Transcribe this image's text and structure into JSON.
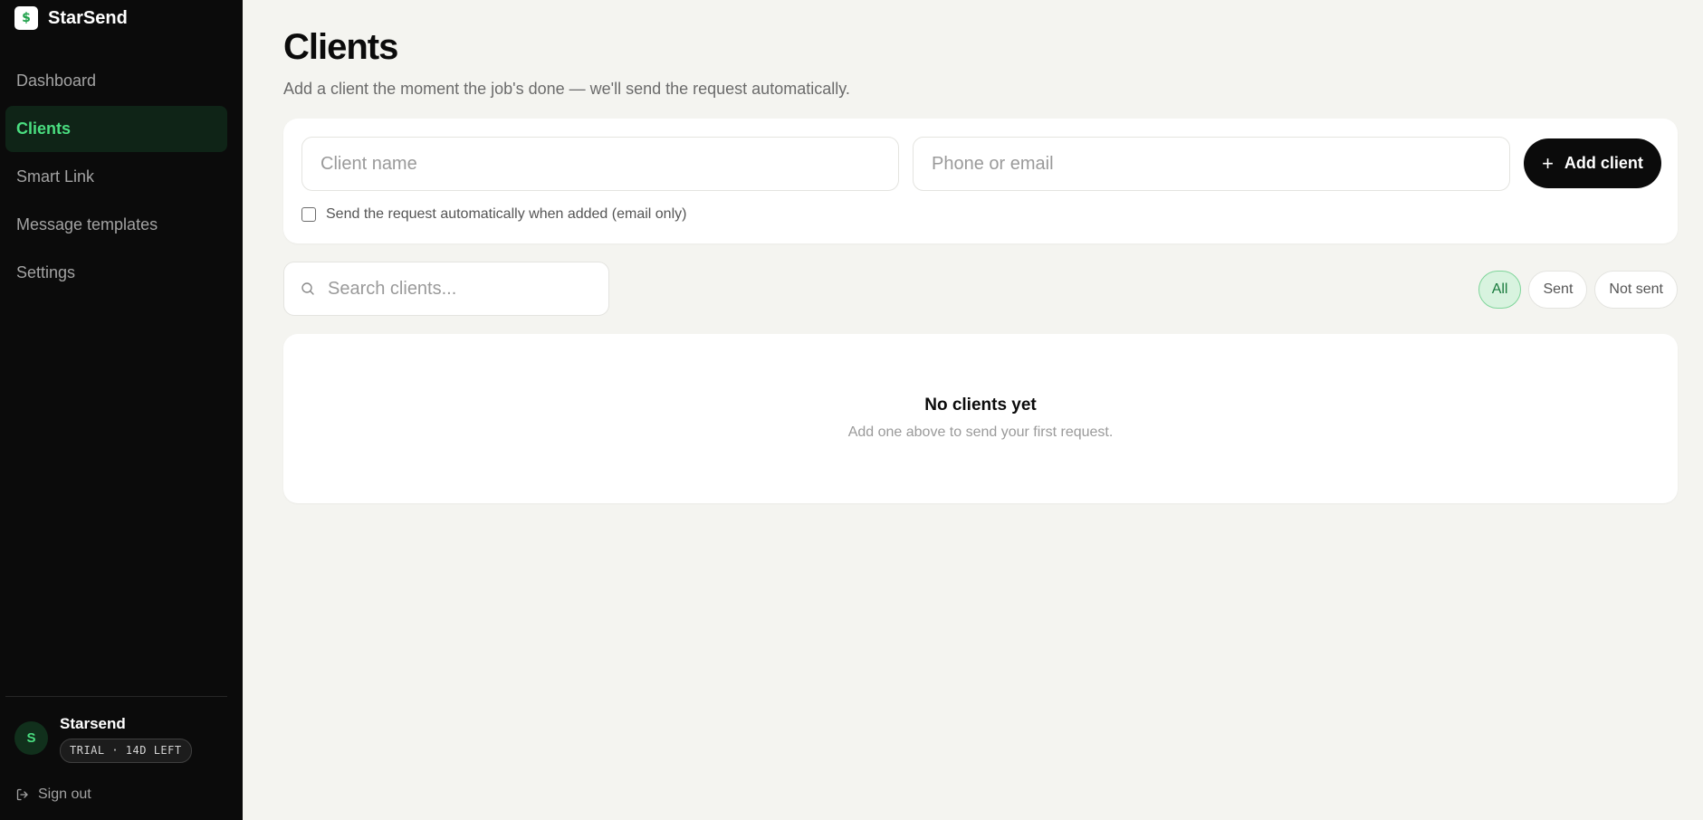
{
  "brand": {
    "name": "StarSend",
    "logo_glyph": "$"
  },
  "sidebar": {
    "items": [
      {
        "label": "Dashboard",
        "active": false
      },
      {
        "label": "Clients",
        "active": true
      },
      {
        "label": "Smart Link",
        "active": false
      },
      {
        "label": "Message templates",
        "active": false
      },
      {
        "label": "Settings",
        "active": false
      }
    ],
    "user": {
      "avatar_initial": "S",
      "name": "Starsend",
      "badge": "TRIAL · 14D LEFT"
    },
    "signout_label": "Sign out"
  },
  "page": {
    "title": "Clients",
    "subtitle": "Add a client the moment the job's done — we'll send the request automatically."
  },
  "add_form": {
    "name_placeholder": "Client name",
    "name_value": "",
    "contact_placeholder": "Phone or email",
    "contact_value": "",
    "add_button_label": "Add client",
    "auto_send_label": "Send the request automatically when added (email only)",
    "auto_send_checked": false
  },
  "search": {
    "placeholder": "Search clients...",
    "value": ""
  },
  "filters": [
    {
      "label": "All",
      "active": true
    },
    {
      "label": "Sent",
      "active": false
    },
    {
      "label": "Not sent",
      "active": false
    }
  ],
  "empty_state": {
    "title": "No clients yet",
    "subtitle": "Add one above to send your first request."
  },
  "colors": {
    "sidebar_bg": "#0b0b0b",
    "accent_green": "#4ade80",
    "active_nav_bg": "#0f2417",
    "page_bg": "#f4f4f0",
    "primary_button": "#0b0b0b"
  },
  "icons": {
    "logo": "dollar-logo-icon",
    "plus": "plus-icon",
    "search": "search-icon",
    "signout": "sign-out-icon"
  }
}
